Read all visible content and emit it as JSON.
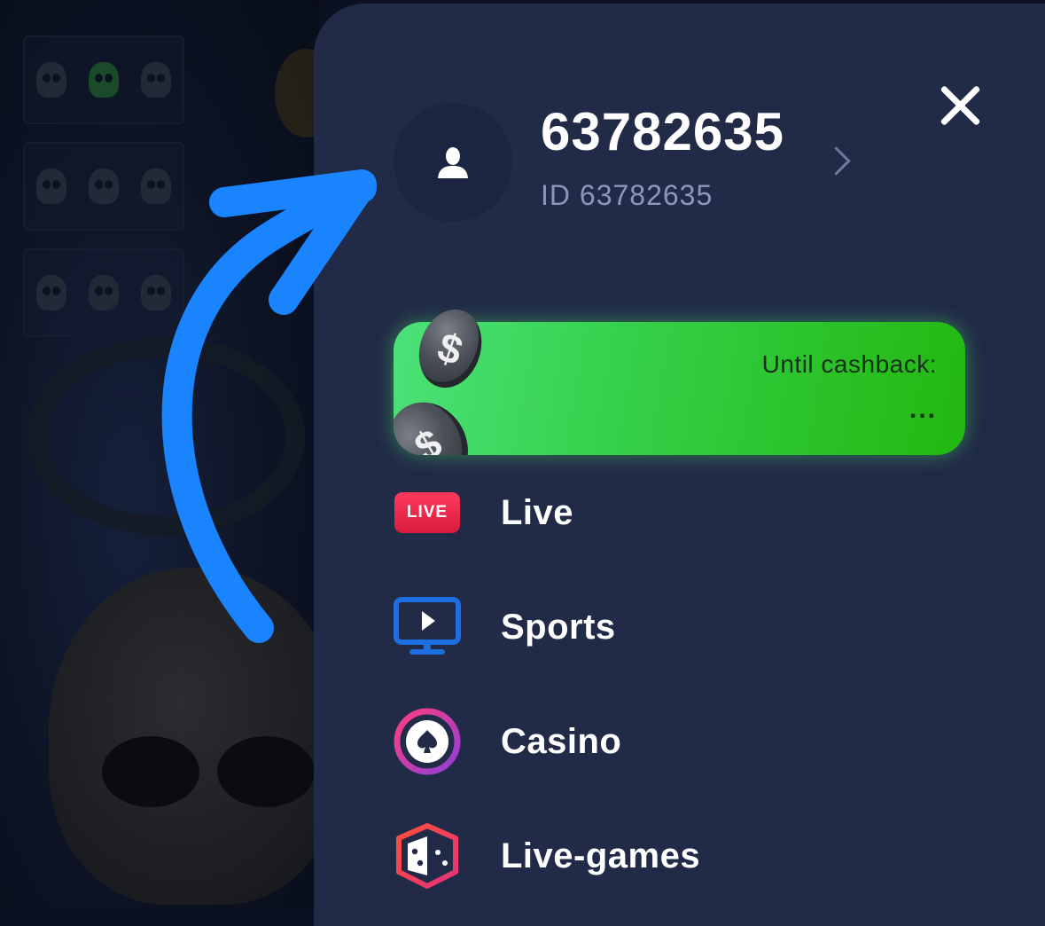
{
  "profile": {
    "name": "63782635",
    "id_text": "ID 63782635"
  },
  "cashback": {
    "label": "Until cashback:",
    "value": "...",
    "coin_symbol": "$"
  },
  "menu": [
    {
      "label": "Live",
      "icon": "live-badge-icon",
      "badge": "LIVE"
    },
    {
      "label": "Sports",
      "icon": "monitor-play-icon"
    },
    {
      "label": "Casino",
      "icon": "spade-chip-icon"
    },
    {
      "label": "Live-games",
      "icon": "dice-icon"
    }
  ],
  "colors": {
    "panel": "#212a47",
    "accent_green": "#2bc41c",
    "annotation_arrow": "#1a84ff",
    "live_red": "#e52345",
    "sports_blue": "#1d6fe0",
    "casino_pink": "#e5337a",
    "games_red": "#ef4a4a"
  }
}
